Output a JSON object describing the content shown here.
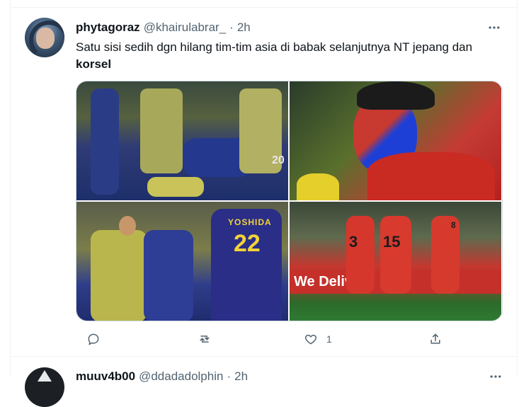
{
  "tweet": {
    "display_name": "phytagoraz",
    "handle": "@khairulabrar_",
    "separator": "·",
    "time": "2h",
    "more_icon": "more-horizontal-icon",
    "text_main": "Satu sisi sedih dgn hilang tim-tim asia di babak selanjutnya NT jepang dan ",
    "text_bold": "korsel",
    "media": {
      "photo1_caption_number": "20",
      "photo3_player_name": "YOSHIDA",
      "photo3_number": "22",
      "photo4_banner": "We Deliver",
      "photo4_number_a": "3",
      "photo4_number_b": "15",
      "photo4_number_c": "8"
    },
    "actions": {
      "reply_icon": "reply-icon",
      "retweet_icon": "retweet-icon",
      "like_icon": "like-icon",
      "like_count": "1",
      "share_icon": "share-icon"
    }
  },
  "next_tweet": {
    "display_name": "muuv4b00",
    "handle": "@ddadadolphin",
    "separator": "·",
    "time": "2h"
  },
  "colors": {
    "text_primary": "#0f1419",
    "text_secondary": "#536471",
    "border": "#eff3f4"
  }
}
